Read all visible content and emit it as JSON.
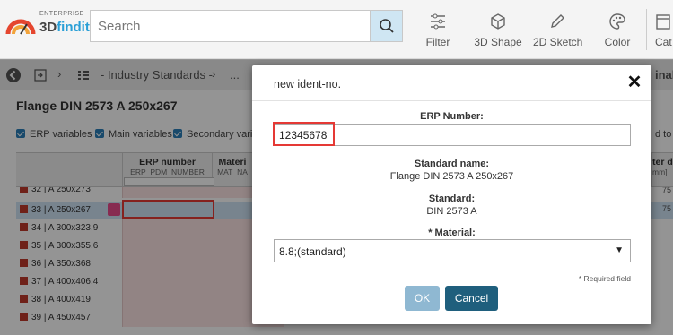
{
  "header": {
    "logo_small": "ENTERPRISE",
    "logo_main_a": "3D",
    "logo_main_b": "findit",
    "search_placeholder": "Search",
    "tools": [
      {
        "label": "Filter",
        "icon": "filter-icon"
      },
      {
        "label": "3D Shape",
        "icon": "cube-icon"
      },
      {
        "label": "2D Sketch",
        "icon": "pencil-icon"
      },
      {
        "label": "Color",
        "icon": "palette-icon"
      },
      {
        "label": "Cat",
        "icon": "catalog-icon"
      }
    ]
  },
  "breadcrumb": {
    "items": [
      "- Industry Standards -",
      "..."
    ],
    "right_fragment": "inal"
  },
  "content": {
    "title": "Flange DIN 2573 A 250x267",
    "options": [
      "ERP variables",
      "Main variables",
      "Secondary variab"
    ],
    "options_right_fragment": "d to l",
    "columns": [
      {
        "title": "ERP number",
        "sub": "ERP_PDM_NUMBER"
      },
      {
        "title": "Materi",
        "sub": "MAT_NA"
      },
      {
        "title": "ter dia",
        "sub": "mm]"
      }
    ],
    "rows": [
      {
        "label": "32 | A 250x273",
        "value": "75"
      },
      {
        "label": "33 | A 250x267",
        "value": "75"
      },
      {
        "label": "34 | A 300x323.9",
        "value": ""
      },
      {
        "label": "35 | A 300x355.6",
        "value": ""
      },
      {
        "label": "36 | A 350x368",
        "value": ""
      },
      {
        "label": "37 | A 400x406.4",
        "value": ""
      },
      {
        "label": "38 | A 400x419",
        "value": ""
      },
      {
        "label": "39 | A 450x457",
        "value": ""
      }
    ]
  },
  "dialog": {
    "title": "new ident-no.",
    "erp_label": "ERP Number:",
    "erp_value": "12345678",
    "standard_name_label": "Standard name:",
    "standard_name_value": "Flange DIN 2573 A 250x267",
    "standard_label": "Standard:",
    "standard_value": "DIN 2573 A",
    "material_label": "* Material:",
    "material_value": "8.8;(standard)",
    "required_note": "* Required field",
    "ok_label": "OK",
    "cancel_label": "Cancel"
  },
  "colors": {
    "accent": "#2a7fb8",
    "cancel_button": "#1f5f7d",
    "ok_button": "#8fb8d2",
    "highlight": "#e53935"
  }
}
